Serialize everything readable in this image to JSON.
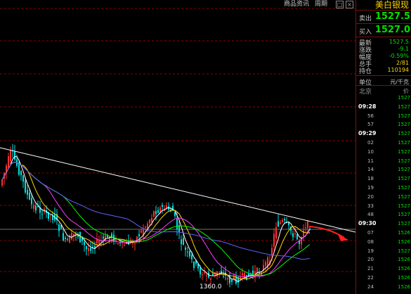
{
  "window": {
    "menu_items": [
      "商品资讯",
      "周期"
    ],
    "buttons": [
      "□",
      "×"
    ]
  },
  "chart": {
    "low_label": "1360.0",
    "colors": {
      "up": "#ff3030",
      "down": "#00e0e0",
      "ma5": "#ffffff",
      "ma10": "#ffd700",
      "ma20": "#ff3cff",
      "ma30": "#00ff00",
      "ma60": "#6060ff",
      "trendline": "#ffffff",
      "arrow": "#ff2020",
      "grid": "#8b0000"
    }
  },
  "panel": {
    "title": "美白银现",
    "sell_label": "卖出",
    "sell_value": "1527.5",
    "buy_label": "买入",
    "buy_value": "1527.0",
    "stats": [
      {
        "label": "最新",
        "value": "1527.5",
        "color": "#00e000"
      },
      {
        "label": "涨跌",
        "value": "-9.1",
        "color": "#00e000"
      },
      {
        "label": "幅度",
        "value": "-0.59%",
        "color": "#00e000"
      },
      {
        "label": "总手",
        "value": "2/81",
        "color": "#ffd700"
      },
      {
        "label": "持仓",
        "value": "110194",
        "color": "#ffd700"
      }
    ],
    "unit_label": "单位",
    "unit_value": "元/千克",
    "col_time": "北京",
    "col_price": "价",
    "ticks": [
      {
        "time": "",
        "min": "",
        "price": "1527"
      },
      {
        "time": "09:28",
        "min": "",
        "price": "1527"
      },
      {
        "time": "",
        "min": "56",
        "price": "1527"
      },
      {
        "time": "",
        "min": "57",
        "price": "1527"
      },
      {
        "time": "09:29",
        "min": "",
        "price": "1527"
      },
      {
        "time": "",
        "min": "02",
        "price": "1527"
      },
      {
        "time": "",
        "min": "10",
        "price": "1527"
      },
      {
        "time": "",
        "min": "11",
        "price": "1527"
      },
      {
        "time": "",
        "min": "14",
        "price": "1527"
      },
      {
        "time": "",
        "min": "18",
        "price": "1527"
      },
      {
        "time": "",
        "min": "19",
        "price": "1527"
      },
      {
        "time": "",
        "min": "20",
        "price": "1527"
      },
      {
        "time": "",
        "min": "33",
        "price": "1527"
      },
      {
        "time": "",
        "min": "48",
        "price": "1527"
      },
      {
        "time": "09:30",
        "min": "",
        "price": "1527"
      },
      {
        "time": "",
        "min": "07",
        "price": "1526"
      },
      {
        "time": "",
        "min": "08",
        "price": "1526"
      },
      {
        "time": "",
        "min": "19",
        "price": "1527"
      },
      {
        "time": "",
        "min": "20",
        "price": "1526"
      },
      {
        "time": "",
        "min": "21",
        "price": "1526"
      },
      {
        "time": "",
        "min": "22",
        "price": "1526"
      },
      {
        "time": "",
        "min": "24",
        "price": "1526"
      }
    ]
  }
}
